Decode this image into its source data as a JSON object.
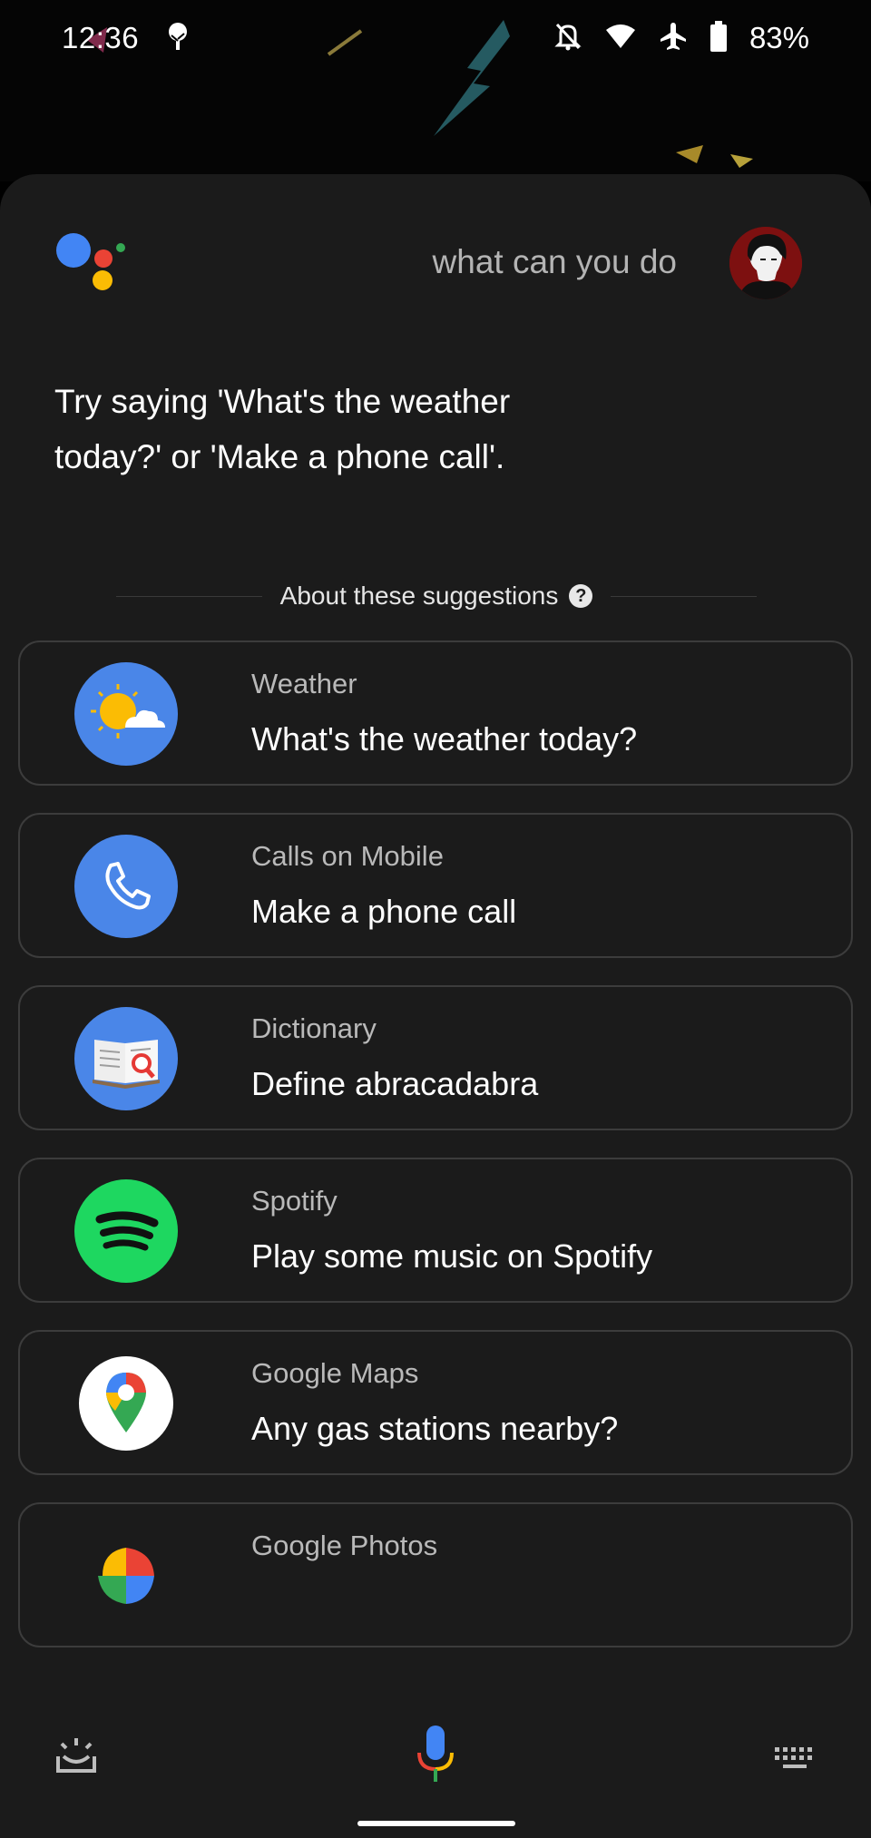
{
  "status_bar": {
    "time": "12:36",
    "battery_percent": "83%",
    "icons": [
      "tree-icon",
      "bell-off-icon",
      "wifi-icon",
      "airplane-icon",
      "battery-icon"
    ]
  },
  "header": {
    "query_text": "what can you do",
    "logo": "google-assistant-logo",
    "avatar": "user-avatar"
  },
  "prompt": {
    "text": "Try saying 'What's the weather today?' or 'Make a phone call'."
  },
  "suggestions_header": {
    "label": "About these suggestions",
    "help_icon_glyph": "?"
  },
  "cards": [
    {
      "category": "Weather",
      "title": "What's the weather today?",
      "icon": "weather-sun-cloud-icon"
    },
    {
      "category": "Calls on Mobile",
      "title": "Make a phone call",
      "icon": "phone-icon"
    },
    {
      "category": "Dictionary",
      "title": "Define abracadabra",
      "icon": "dictionary-book-icon"
    },
    {
      "category": "Spotify",
      "title": "Play some music on Spotify",
      "icon": "spotify-icon"
    },
    {
      "category": "Google Maps",
      "title": "Any gas stations nearby?",
      "icon": "google-maps-icon"
    },
    {
      "category": "Google Photos",
      "title": "",
      "icon": "google-photos-icon"
    }
  ],
  "bottom_bar": {
    "icons": [
      "snapshot-icon",
      "microphone-icon",
      "keyboard-icon"
    ]
  },
  "colors": {
    "sheet_bg": "#1b1b1b",
    "card_border": "#3c3c3c",
    "google_blue": "#4285f4",
    "google_red": "#ea4335",
    "google_yellow": "#fbbc04",
    "google_green": "#34a853",
    "spotify_green": "#1ed760"
  }
}
